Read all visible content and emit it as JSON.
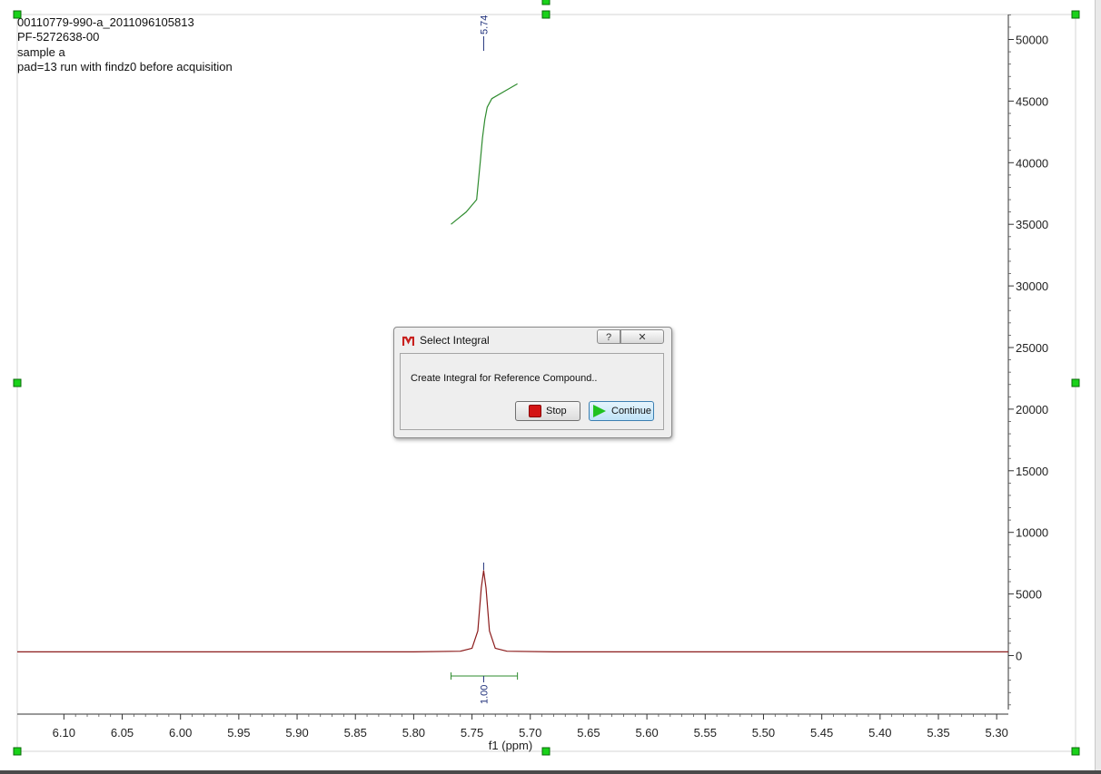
{
  "sample_info": {
    "line1": "00110779-990-a_2011096105813",
    "line2": "PF-5272638-00",
    "line3": "sample a",
    "line4": "pad=13 run with findz0 before acquisition"
  },
  "chart_data": {
    "type": "line",
    "title": "",
    "xlabel": "f1 (ppm)",
    "ylabel": "",
    "xlim": [
      6.14,
      5.29
    ],
    "ylim": [
      -4500,
      52000
    ],
    "x_reversed": true,
    "x_ticks": [
      "6.10",
      "6.05",
      "6.00",
      "5.95",
      "5.90",
      "5.85",
      "5.80",
      "5.75",
      "5.70",
      "5.65",
      "5.60",
      "5.55",
      "5.50",
      "5.45",
      "5.40",
      "5.35",
      "5.30"
    ],
    "y_ticks": [
      "50000",
      "45000",
      "40000",
      "35000",
      "30000",
      "25000",
      "20000",
      "15000",
      "10000",
      "5000",
      "0"
    ],
    "series": [
      {
        "color": "#8b1a1a",
        "x": [
          6.14,
          5.8,
          5.76,
          5.75,
          5.745,
          5.742,
          5.74,
          5.738,
          5.735,
          5.73,
          5.72,
          5.68,
          5.29
        ],
        "y": [
          300,
          300,
          350,
          600,
          2000,
          5500,
          6900,
          5500,
          2000,
          600,
          350,
          300,
          300
        ]
      },
      {
        "color": "#2e8b2e",
        "x": [
          5.768,
          5.755,
          5.746,
          5.743,
          5.741,
          5.739,
          5.737,
          5.733,
          5.722,
          5.711
        ],
        "y": [
          35000,
          36000,
          37000,
          40000,
          42000,
          43500,
          44500,
          45200,
          45800,
          46400
        ]
      }
    ],
    "peak_label": "5.74",
    "peak_label_x": 5.74,
    "integral": {
      "from": 5.768,
      "to": 5.711,
      "value": "1.00"
    }
  },
  "dialog": {
    "title": "Select Integral",
    "help_label": "?",
    "close_label": "✕",
    "message": "Create Integral for Reference Compound..",
    "stop_label": "Stop",
    "continue_label": "Continue"
  },
  "colors": {
    "spectrum": "#8b1a1a",
    "integral_curve": "#2e8b2e",
    "peak_marker": "#1e2f7a",
    "handles": "#19d219"
  }
}
